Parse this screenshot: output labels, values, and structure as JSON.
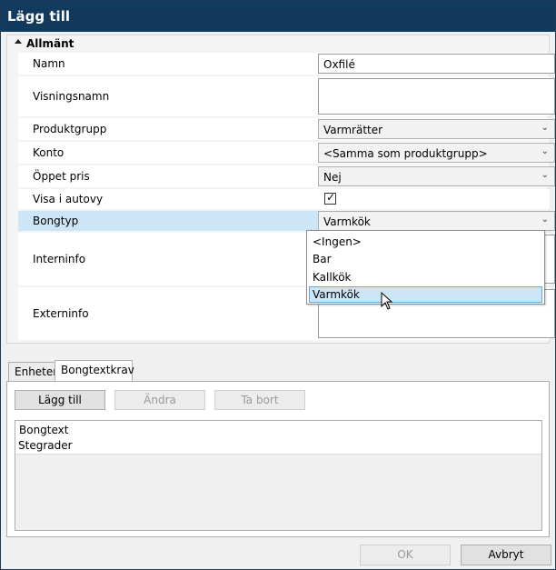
{
  "window": {
    "title": "Lägg till"
  },
  "category": {
    "label": "Allmänt"
  },
  "properties": [
    {
      "name": "Namn",
      "value": "Oxfilé"
    },
    {
      "name": "Visningsnamn",
      "value": ""
    },
    {
      "name": "Produktgrupp",
      "value": "Varmrätter"
    },
    {
      "name": "Konto",
      "value": "<Samma som produktgrupp>"
    },
    {
      "name": "Öppet pris",
      "value": "Nej"
    },
    {
      "name": "Visa i autovy",
      "value": "✓"
    },
    {
      "name": "Bongtyp",
      "value": "Varmkök"
    },
    {
      "name": "Interninfo",
      "value": ""
    },
    {
      "name": "Externinfo",
      "value": ""
    }
  ],
  "dropdown": {
    "options": [
      "<Ingen>",
      "Bar",
      "Kallkök",
      "Varmkök"
    ],
    "highlighted": "Varmkök"
  },
  "tabs": [
    {
      "label": "Enheter"
    },
    {
      "label": "Bongtextkrav"
    }
  ],
  "toolbar": {
    "add": "Lägg till",
    "edit": "Ändra",
    "delete": "Ta bort"
  },
  "grid": {
    "column": "Bongtext",
    "rows": [
      "Stegrader"
    ]
  },
  "footer": {
    "ok": "OK",
    "cancel": "Avbryt"
  },
  "icons": {
    "chevron": "chevron-down-icon",
    "check": "check-icon",
    "collapse": "collapse-triangle-icon",
    "cursor": "mouse-pointer-icon"
  }
}
